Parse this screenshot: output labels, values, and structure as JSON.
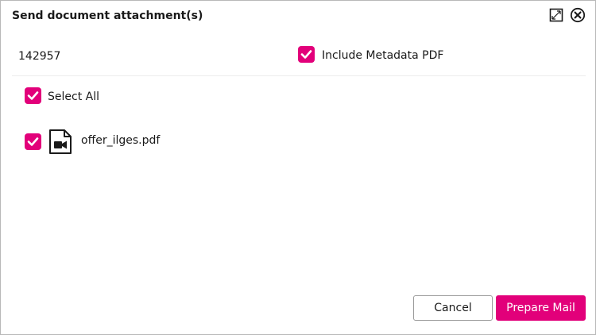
{
  "dialog": {
    "title": "Send document attachment(s)",
    "maximize_icon": "maximize-icon",
    "close_icon": "close-circle-icon"
  },
  "header_row": {
    "document_id": "142957",
    "include_metadata": {
      "label": "Include Metadata PDF",
      "checked": true
    }
  },
  "select_all": {
    "label": "Select All",
    "checked": true
  },
  "attachments": [
    {
      "filename": "offer_ilges.pdf",
      "checked": true,
      "icon": "video-file-icon"
    }
  ],
  "footer": {
    "cancel_label": "Cancel",
    "prepare_label": "Prepare Mail"
  },
  "colors": {
    "accent": "#e2007a",
    "text": "#1a1a1a",
    "border": "#9a9a9a"
  }
}
